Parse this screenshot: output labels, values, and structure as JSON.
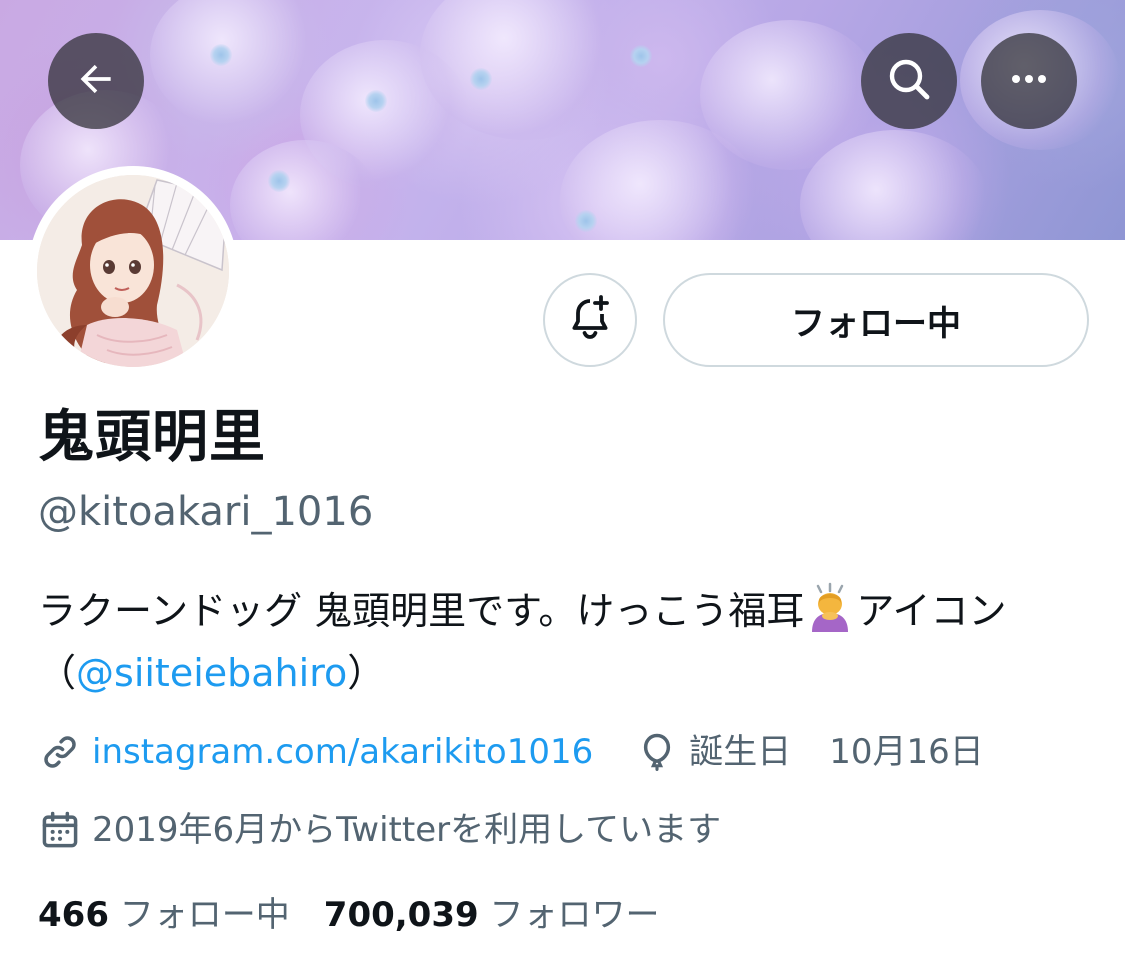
{
  "header": {
    "back_icon": "arrow-left-icon",
    "search_icon": "search-icon",
    "more_icon": "more-horizontal-icon"
  },
  "profile": {
    "display_name": "鬼頭明里",
    "handle": "@kitoakari_1016",
    "bio_text": "ラクーンドッグ 鬼頭明里です。けっこう福耳",
    "bio_emoji": "🙇‍♀️",
    "bio_after_emoji": "アイコン（",
    "bio_mention": "@siiteiebahiro",
    "bio_close": "）",
    "website": "instagram.com/akarikito1016",
    "birthday_label": "誕生日",
    "birthday_value": "10月16日",
    "joined": "2019年6月からTwitterを利用しています"
  },
  "actions": {
    "notify_icon": "bell-plus-icon",
    "follow_label": "フォロー中"
  },
  "stats": {
    "following_count": "466",
    "following_label": "フォロー中",
    "followers_count": "700,039",
    "followers_label": "フォロワー"
  },
  "colors": {
    "link": "#1d9bf0",
    "secondary_text": "#536471",
    "button_border": "#cfd9de"
  }
}
